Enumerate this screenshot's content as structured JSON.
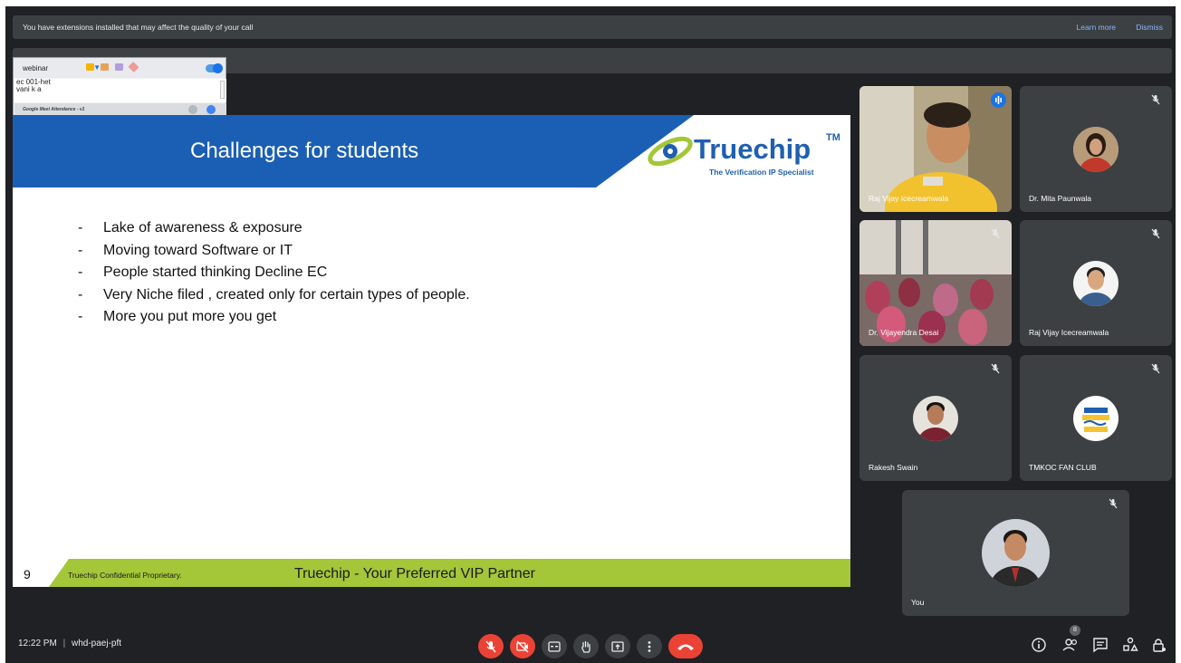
{
  "banner": {
    "text": "You have extensions installed that may affect the quality of your call",
    "learn_more": "Learn more",
    "dismiss": "Dismiss"
  },
  "extension": {
    "dropdown_value": "webinar",
    "list": [
      "ec 001-het",
      "vani k a"
    ],
    "footer": "Google Meet Attendance - v1"
  },
  "slide": {
    "title": "Challenges for students",
    "logo_main": "Truechip",
    "logo_tm": "TM",
    "logo_tagline": "The Verification IP Specialist",
    "bullets": [
      "Lake of awareness & exposure",
      "Moving toward Software or IT",
      "People started thinking Decline EC",
      "Very Niche filed , created only for certain types of people.",
      "More you put more you get"
    ],
    "bullet_marker": "-",
    "page_number": "9",
    "confidential": "Truechip Confidential Proprietary.",
    "tagline": "Truechip - Your Preferred VIP Partner",
    "colors": {
      "header_blue": "#1b5fb4",
      "footer_green": "#a4c639",
      "brand_blue": "#1f5fb0"
    }
  },
  "participants": [
    {
      "name": "Raj Vijay Icecreamwala",
      "video": true,
      "speaking": true
    },
    {
      "name": "Dr. Mita Paunwala",
      "muted": true
    },
    {
      "name": "Dr. Vijayendra Desai",
      "video": true,
      "muted": true
    },
    {
      "name": "Raj Vijay Icecreamwala",
      "muted": true
    },
    {
      "name": "Rakesh Swain",
      "muted": true
    },
    {
      "name": "TMKOC FAN CLUB",
      "muted": true
    },
    {
      "name": "You",
      "muted": true
    }
  ],
  "bottom": {
    "time": "12:22 PM",
    "separator": "|",
    "meeting_code": "whd-paej-pft",
    "people_count": "8",
    "colors": {
      "danger": "#ea4335",
      "control_bg": "#3c4043"
    }
  }
}
